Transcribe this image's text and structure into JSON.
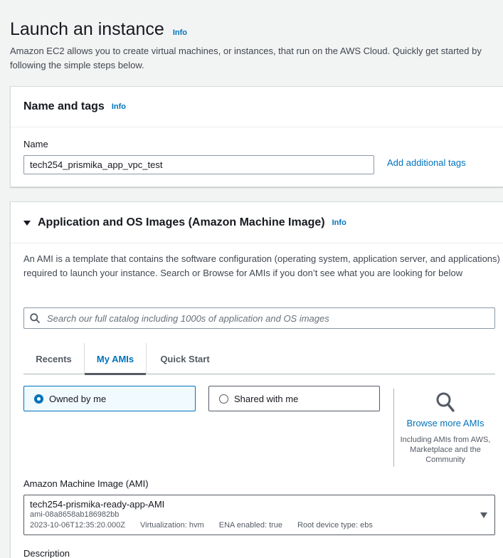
{
  "header": {
    "title": "Launch an instance",
    "info": "Info",
    "description": "Amazon EC2 allows you to create virtual machines, or instances, that run on the AWS Cloud. Quickly get started by following the simple steps below."
  },
  "name_tags": {
    "title": "Name and tags",
    "info": "Info",
    "name_label": "Name",
    "name_value": "tech254_prismika_app_vpc_test",
    "add_tags": "Add additional tags"
  },
  "ami": {
    "title": "Application and OS Images (Amazon Machine Image)",
    "info": "Info",
    "description": "An AMI is a template that contains the software configuration (operating system, application server, and applications) required to launch your instance. Search or Browse for AMIs if you don’t see what you are looking for below",
    "search_placeholder": "Search our full catalog including 1000s of application and OS images",
    "tabs": [
      "Recents",
      "My AMIs",
      "Quick Start"
    ],
    "owned_by_me": "Owned by me",
    "shared_with_me": "Shared with me",
    "browse_more": "Browse more AMIs",
    "browse_sub": "Including AMIs from AWS, Marketplace and the Community",
    "select_label": "Amazon Machine Image (AMI)",
    "selected": {
      "name": "tech254-prismika-ready-app-AMI",
      "id": "ami-08a8658ab186982bb",
      "date": "2023-10-06T12:35:20.000Z",
      "virtualization": "Virtualization: hvm",
      "ena": "ENA enabled: true",
      "root_device": "Root device type: ebs"
    },
    "description_label": "Description"
  },
  "colors": {
    "link": "#0073bb",
    "background": "#f2f3f3",
    "selected_tile_bg": "#f1faff"
  }
}
